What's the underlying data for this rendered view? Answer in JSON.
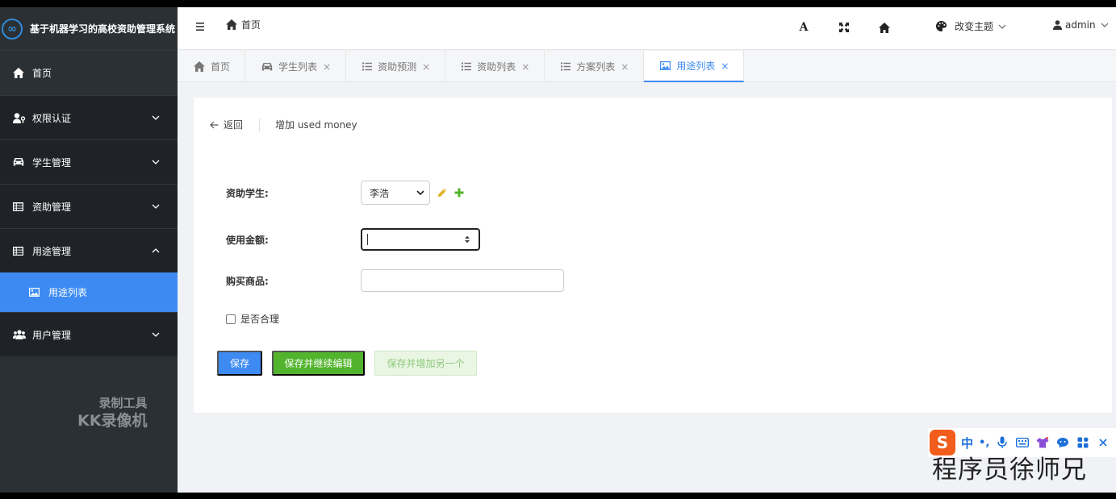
{
  "app": {
    "title": "基于机器学习的高校资助管理系统",
    "logo_glyph": "∞"
  },
  "sidebar": {
    "items": [
      {
        "label": "首页",
        "icon": "home-icon"
      },
      {
        "label": "权限认证",
        "icon": "user-key-icon"
      },
      {
        "label": "学生管理",
        "icon": "car-icon"
      },
      {
        "label": "资助管理",
        "icon": "table-icon"
      },
      {
        "label": "用途管理",
        "icon": "table-icon"
      },
      {
        "label": "用户管理",
        "icon": "users-icon"
      }
    ],
    "sub_item": {
      "label": "用途列表",
      "icon": "image-icon"
    },
    "watermark_line1": "录制工具",
    "watermark_line2": "KK录像机"
  },
  "header": {
    "breadcrumb_home": "首页",
    "theme_label": "改变主题",
    "user_label": "admin",
    "font_tool_glyph": "A"
  },
  "tabs": [
    {
      "label": "首页",
      "closable": false
    },
    {
      "label": "学生列表",
      "closable": true
    },
    {
      "label": "资助预测",
      "closable": true
    },
    {
      "label": "资助列表",
      "closable": true
    },
    {
      "label": "方案列表",
      "closable": true
    },
    {
      "label": "用途列表",
      "closable": true
    }
  ],
  "close_glyph": "×",
  "page": {
    "back_label": "返回",
    "title": "增加 used money"
  },
  "form": {
    "student_label": "资助学生:",
    "student_value": "李浩",
    "amount_label": "使用金额:",
    "amount_value": "",
    "goods_label": "购买商品:",
    "goods_value": "",
    "reasonable_label": "是否合理"
  },
  "buttons": {
    "save": "保存",
    "save_continue": "保存并继续编辑",
    "save_add_another": "保存并增加另一个"
  },
  "ime": {
    "logo_glyph": "S",
    "lang_glyph": "中",
    "punct_glyph": "•,"
  },
  "author_watermark": "程序员徐师兄",
  "colors": {
    "sidebar_bg": "#2b3034",
    "accent_blue": "#3d8bf2",
    "accent_green": "#52b42d",
    "light_green": "#eaf6e4"
  }
}
